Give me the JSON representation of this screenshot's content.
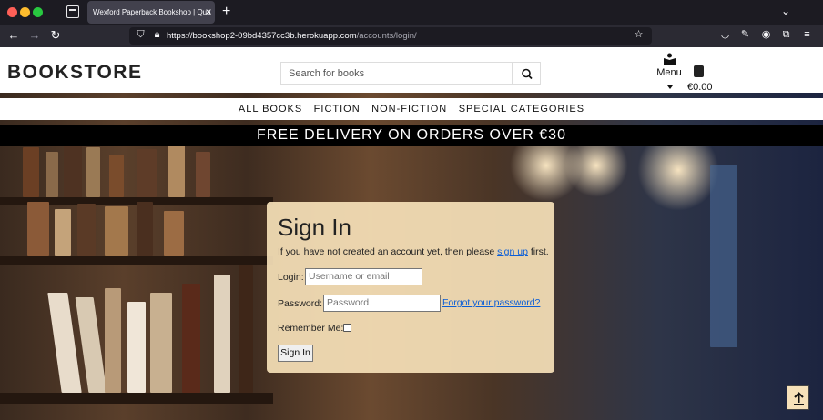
{
  "browser": {
    "tab_title": "Wexford Paperback Bookshop | Qua",
    "tab_close": "×",
    "new_tab": "+",
    "url_host": "https://bookshop2-09bd4357cc3b.herokuapp.com",
    "url_path": "/accounts/login/"
  },
  "header": {
    "logo": "BOOKSTORE",
    "search_placeholder": "Search for books",
    "menu_label": "Menu",
    "cart_total": "€0.00"
  },
  "nav": {
    "items": [
      "ALL BOOKS",
      "FICTION",
      "NON-FICTION",
      "SPECIAL CATEGORIES"
    ]
  },
  "promo": "FREE DELIVERY ON ORDERS OVER €30",
  "signin": {
    "title": "Sign In",
    "intro_before": "If you have not created an account yet, then please ",
    "intro_link": "sign up",
    "intro_after": " first.",
    "login_label": "Login:",
    "login_placeholder": "Username or email",
    "password_label": "Password:",
    "password_placeholder": "Password",
    "forgot_link": "Forgot your password?",
    "remember_label": "Remember Me:",
    "button": "Sign In"
  },
  "colors": {
    "card": "#f6e1b9",
    "link": "#0b5ed7",
    "promo_bg": "#000000"
  }
}
